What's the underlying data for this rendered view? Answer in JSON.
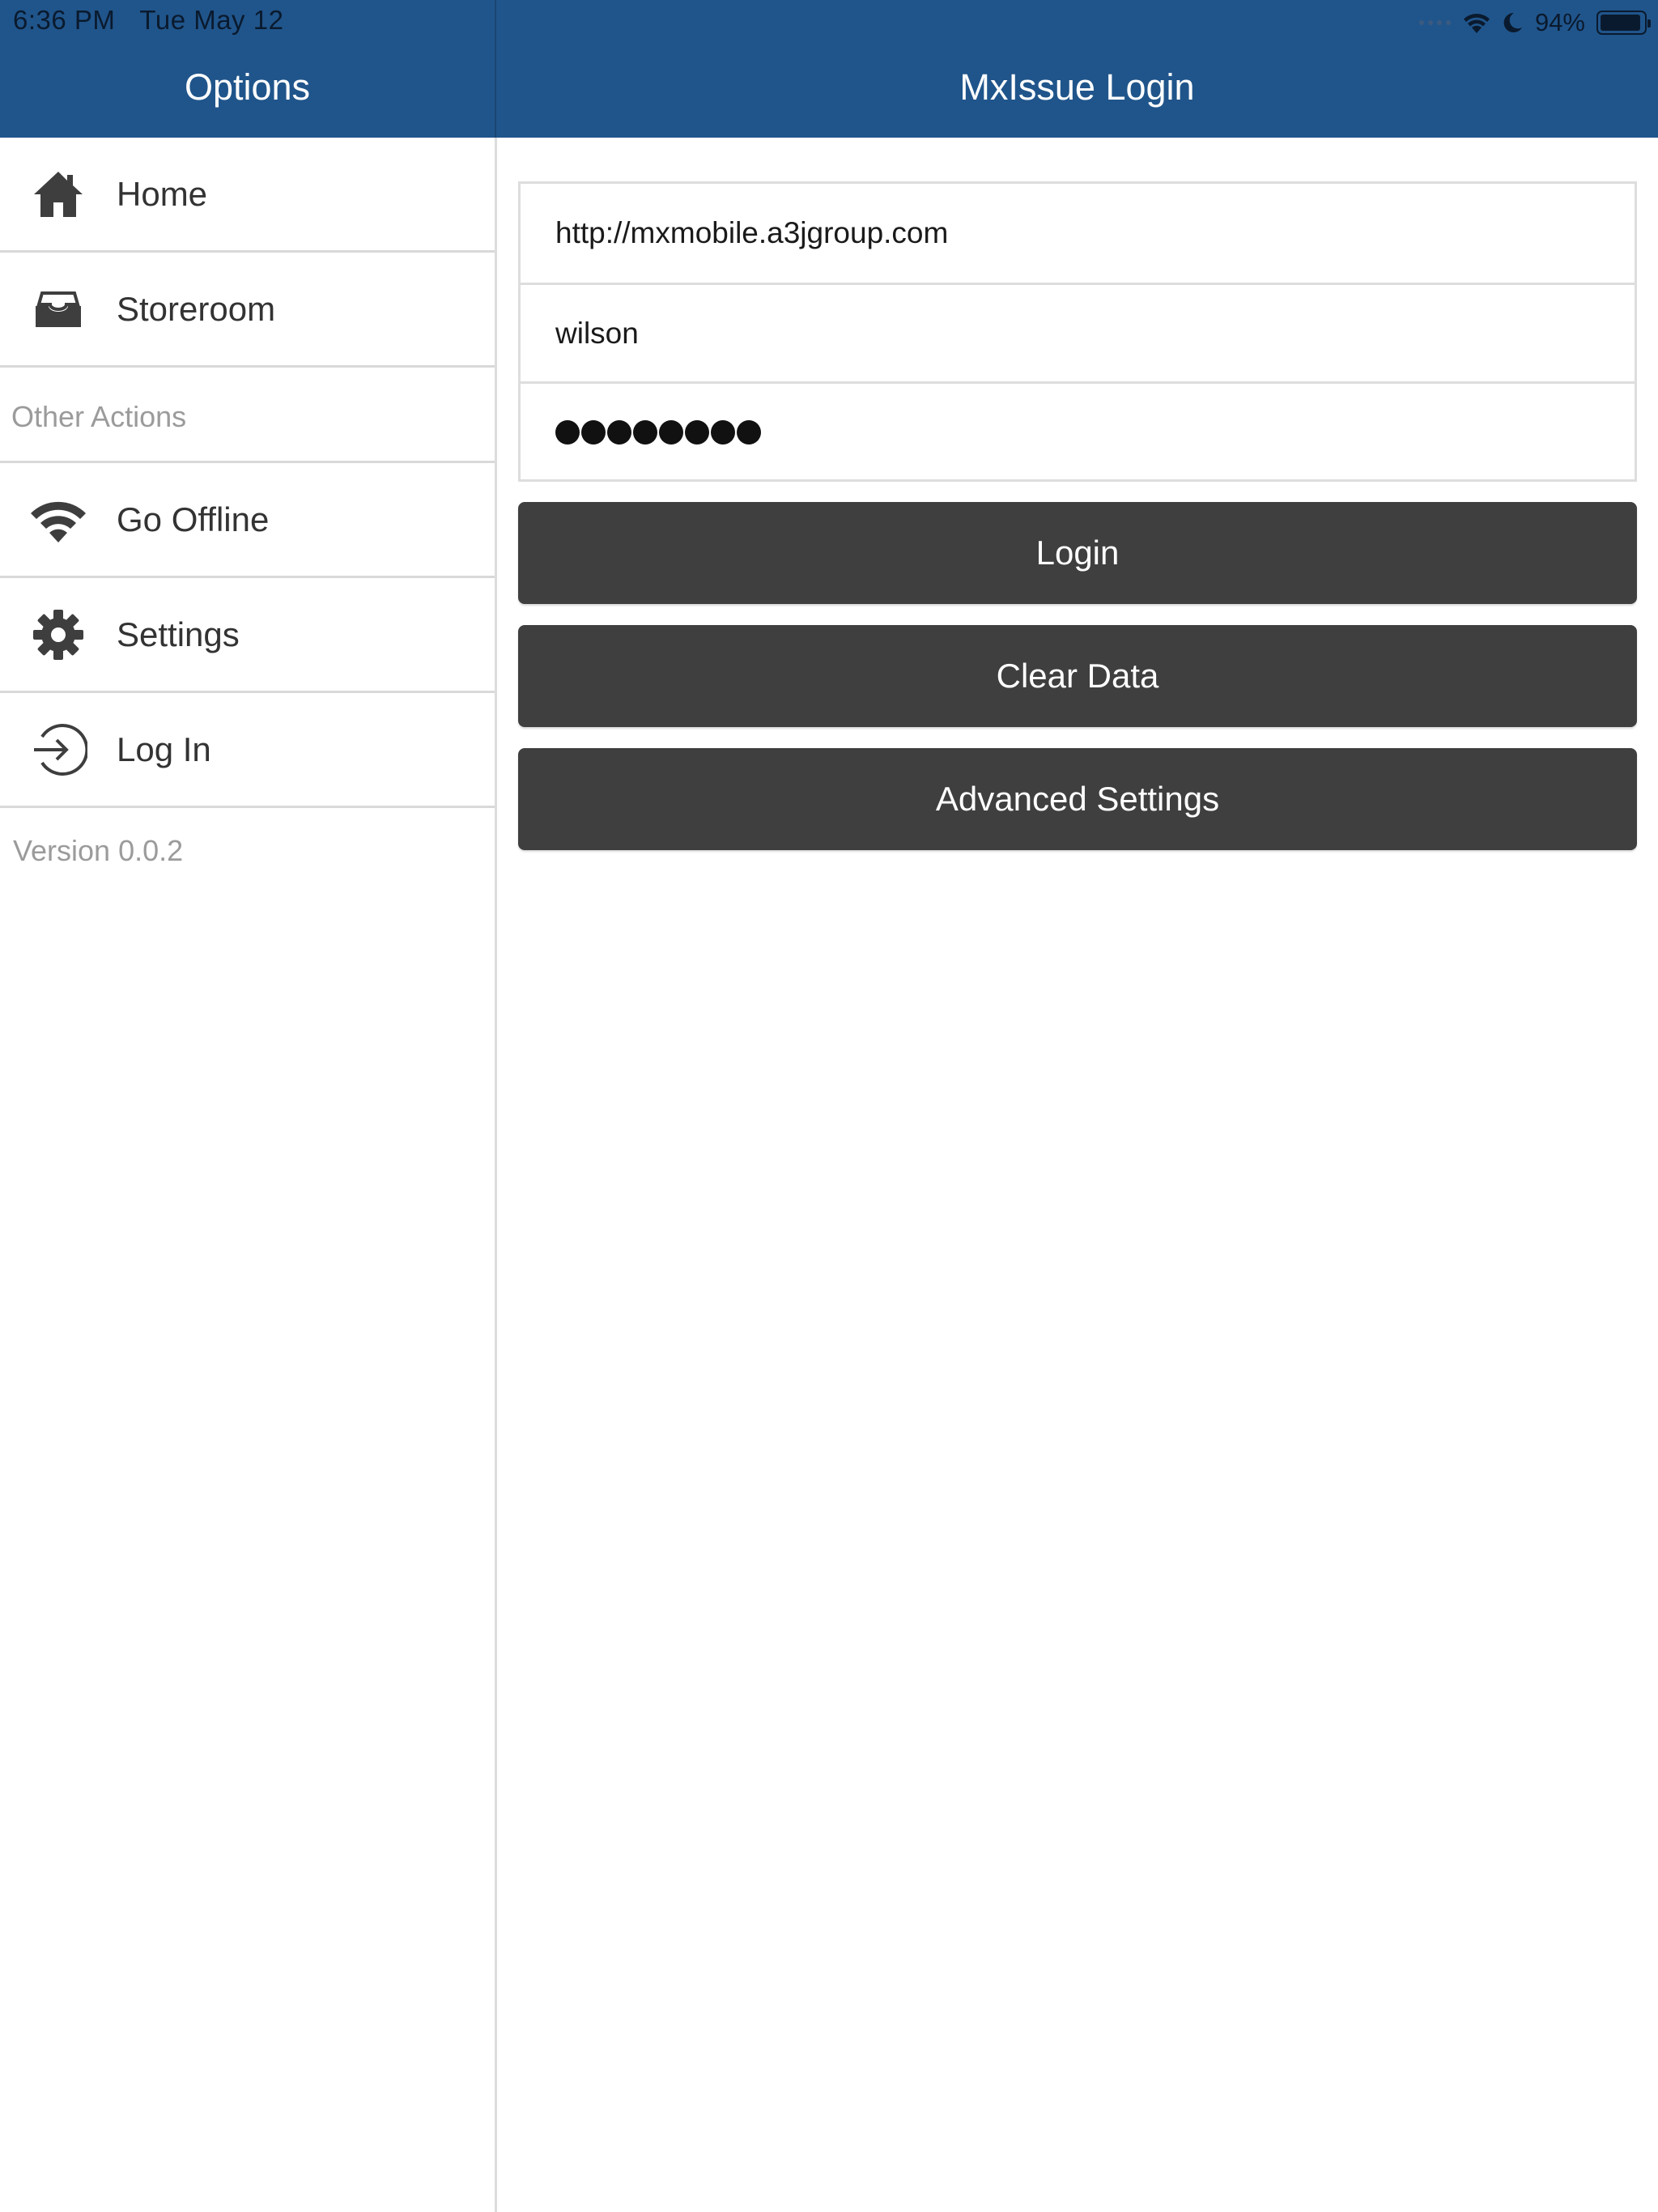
{
  "status_bar": {
    "time": "6:36 PM",
    "date": "Tue May 12",
    "battery": "94%",
    "battery_level": 0.94
  },
  "sidebar": {
    "title": "Options",
    "items": [
      {
        "label": "Home",
        "icon": "home-icon"
      },
      {
        "label": "Storeroom",
        "icon": "storeroom-icon"
      }
    ],
    "section_label": "Other Actions",
    "other_items": [
      {
        "label": "Go Offline",
        "icon": "wifi-icon"
      },
      {
        "label": "Settings",
        "icon": "gear-icon"
      },
      {
        "label": "Log In",
        "icon": "login-icon"
      }
    ],
    "version": "Version 0.0.2"
  },
  "main": {
    "title": "MxIssue Login",
    "form": {
      "server_url": "http://mxmobile.a3jgroup.com",
      "username": "wilson",
      "password_length": 8
    },
    "buttons": {
      "login": "Login",
      "clear_data": "Clear Data",
      "advanced_settings": "Advanced Settings"
    }
  },
  "colors": {
    "header_blue": "#20558b",
    "button_dark": "#3f3f3f"
  }
}
